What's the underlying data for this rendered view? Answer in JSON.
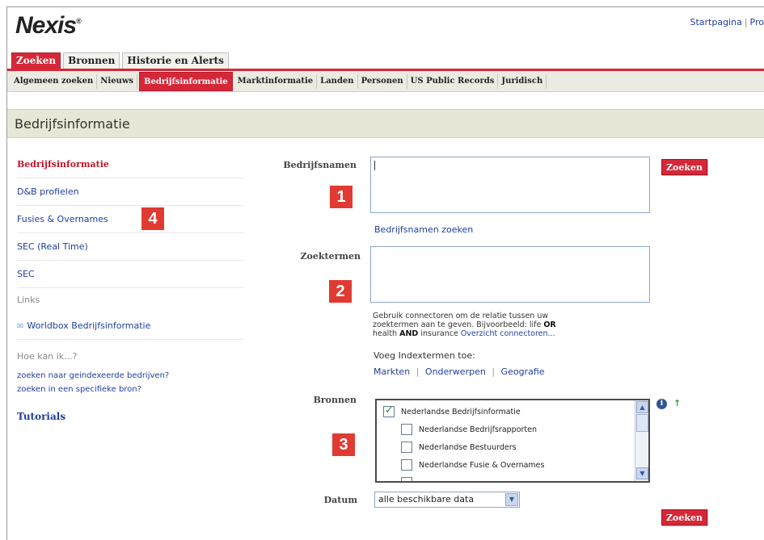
{
  "header": {
    "logo": "Nexis",
    "logo_mark": "®",
    "links": [
      "Startpagina",
      "Pro"
    ]
  },
  "main_tabs": [
    {
      "label": "Zoeken",
      "active": true
    },
    {
      "label": "Bronnen",
      "active": false
    },
    {
      "label": "Historie en Alerts",
      "active": false
    }
  ],
  "sub_nav": [
    {
      "label": "Algemeen zoeken",
      "active": false
    },
    {
      "label": "Nieuws",
      "active": false
    },
    {
      "label": "Bedrijfsinformatie",
      "active": true
    },
    {
      "label": "Marktinformatie",
      "active": false
    },
    {
      "label": "Landen",
      "active": false
    },
    {
      "label": "Personen",
      "active": false
    },
    {
      "label": "US Public Records",
      "active": false
    },
    {
      "label": "Juridisch",
      "active": false
    }
  ],
  "page_title": "Bedrijfsinformatie",
  "sidebar": {
    "items": [
      {
        "label": "Bedrijfsinformatie",
        "active": true
      },
      {
        "label": "D&B profielen"
      },
      {
        "label": "Fusies & Overnames"
      },
      {
        "label": "SEC (Real Time)"
      },
      {
        "label": "SEC"
      }
    ],
    "links_heading": "Links",
    "worldbox": "Worldbox Bedrijfsinformatie",
    "howto_heading": "Hoe kan ik...?",
    "howto_links": [
      "zoeken naar geindexeerde bedrijven?",
      "zoeken in een specifieke bron?"
    ],
    "tutorials": "Tutorials"
  },
  "form": {
    "bedrijfsnamen_label": "Bedrijfsnamen",
    "bedrijfsnamen_value": "",
    "zoeken_label": "Zoeken",
    "bedrijfsnamen_zoeken": "Bedrijfsnamen zoeken",
    "zoektermen_label": "Zoektermen",
    "zoektermen_value": "",
    "hint_line1": "Gebruik connectoren om de relatie tussen uw",
    "hint_line2": "zoektermen aan te geven. Bijvoorbeeld: life",
    "hint_or": "OR",
    "hint_line3": "health",
    "hint_and": "AND",
    "hint_line3b": "insurance",
    "hint_link": "Overzicht connectoren...",
    "index_heading": "Voeg Indextermen toe:",
    "index_links": [
      "Markten",
      "Onderwerpen",
      "Geografie"
    ],
    "bronnen_label": "Bronnen",
    "sources": [
      {
        "label": "Nederlandse Bedrijfsinformatie",
        "checked": true
      },
      {
        "label": "Nederlandse Bedrijfsrapporten",
        "checked": false
      },
      {
        "label": "Nederlandse Bestuurders",
        "checked": false
      },
      {
        "label": "Nederlandse Fusie & Overnames",
        "checked": false
      }
    ],
    "datum_label": "Datum",
    "datum_value": "alle beschikbare data"
  },
  "badges": [
    "1",
    "2",
    "3",
    "4"
  ],
  "colors": {
    "accent_red": "#d62738",
    "link_blue": "#1f3f9e",
    "badge_red": "#e03a32"
  }
}
